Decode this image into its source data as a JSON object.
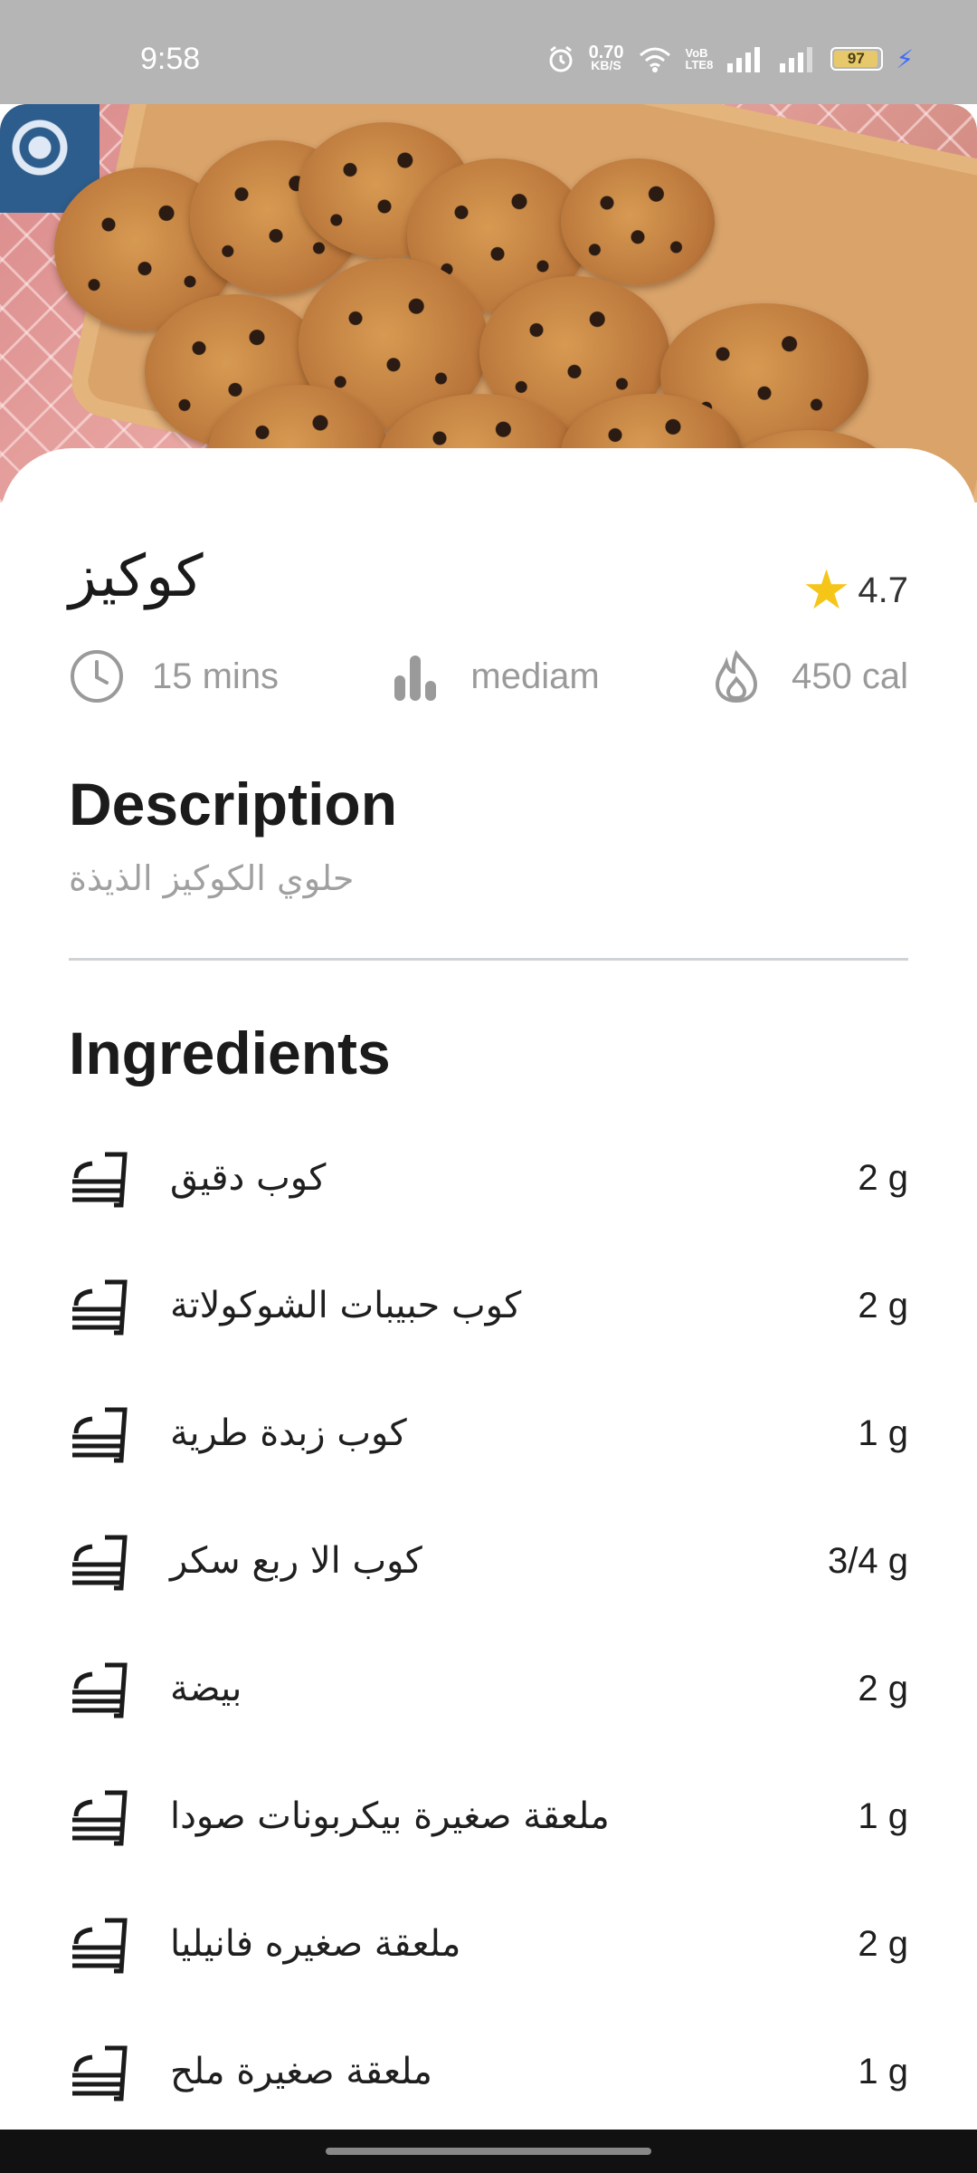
{
  "status_bar": {
    "time": "9:58",
    "net_speed_value": "0.70",
    "net_speed_unit": "KB/S",
    "network_label_top": "VoB",
    "network_label_bottom": "LTE8",
    "battery": "97",
    "icons": [
      "alarm-icon",
      "wifi-icon",
      "signal-icon",
      "signal-icon",
      "battery-icon",
      "charging-icon"
    ]
  },
  "recipe": {
    "title": "كوكيز",
    "rating": "4.7",
    "time": "15 mins",
    "difficulty": "mediam",
    "calories": "450 cal"
  },
  "description": {
    "heading": "Description",
    "text": "حلوي الكوكيز الذيذة"
  },
  "ingredients": {
    "heading": "Ingredients",
    "items": [
      {
        "name": "كوب دقيق",
        "qty": "2 g"
      },
      {
        "name": "كوب حبيبات الشوكولاتة",
        "qty": "2 g"
      },
      {
        "name": "كوب زبدة طرية",
        "qty": "1 g"
      },
      {
        "name": "كوب الا ربع سكر",
        "qty": "3/4 g"
      },
      {
        "name": "بيضة",
        "qty": "2 g"
      },
      {
        "name": "ملعقة صغيرة بيكربونات صودا",
        "qty": "1 g"
      },
      {
        "name": "ملعقة صغيره فانيليا",
        "qty": "2 g"
      },
      {
        "name": "ملعقة صغيرة ملح",
        "qty": "1 g"
      }
    ]
  },
  "colors": {
    "star": "#f5c518",
    "muted": "#9a9a9a",
    "text": "#1b1b1b"
  }
}
